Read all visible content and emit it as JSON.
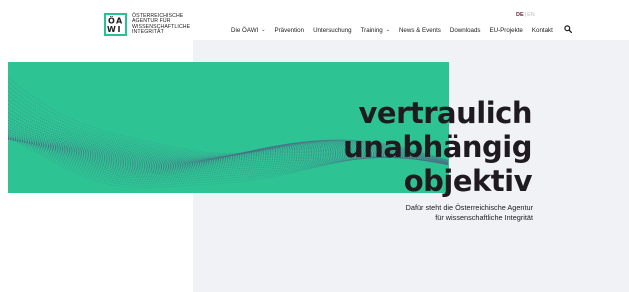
{
  "brand": {
    "logo_letters": [
      "Ö",
      "A",
      "W",
      "I"
    ],
    "logo_lines": [
      "ÖSTERREICHISCHE",
      "AGENTUR FÜR",
      "WISSENSCHAFTLICHE",
      "INTEGRITÄT"
    ],
    "accent_color": "#2dc393",
    "text_color": "#1e1a1e"
  },
  "language": {
    "active": "DE",
    "separator": "|",
    "inactive": "EN"
  },
  "nav": {
    "items": [
      {
        "label": "Die ÖAWI",
        "dropdown": true
      },
      {
        "label": "Prävention",
        "dropdown": false
      },
      {
        "label": "Untersuchung",
        "dropdown": false
      },
      {
        "label": "Training",
        "dropdown": true
      },
      {
        "label": "News & Events",
        "dropdown": false
      },
      {
        "label": "Downloads",
        "dropdown": false
      },
      {
        "label": "EU-Projekte",
        "dropdown": false
      },
      {
        "label": "Kontakt",
        "dropdown": false
      }
    ],
    "search_icon": "search-icon",
    "chevron_glyph": "⌄"
  },
  "hero": {
    "headline": [
      "vertraulich",
      "unabhängig",
      "objektiv"
    ],
    "subline": [
      "Dafür steht die Österreichische Agentur",
      "für wissenschaftliche Integrität"
    ]
  }
}
